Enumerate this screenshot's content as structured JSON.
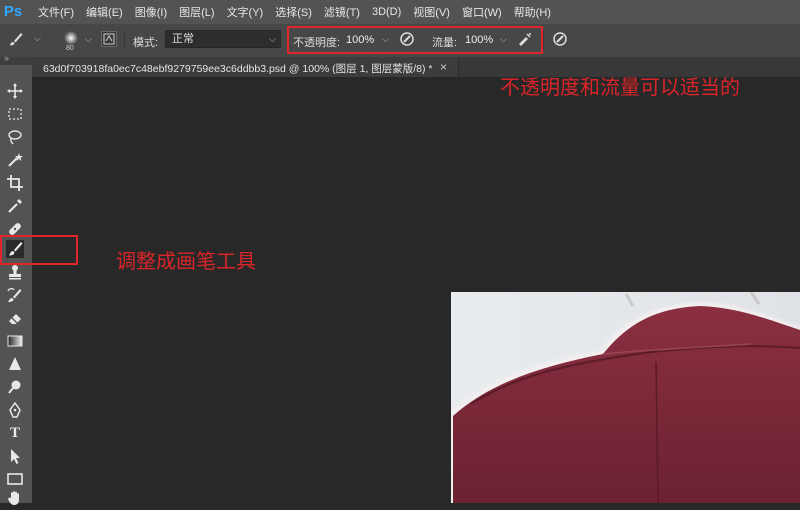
{
  "app": {
    "logo": "Ps"
  },
  "menu": [
    "文件(F)",
    "编辑(E)",
    "图像(I)",
    "图层(L)",
    "文字(Y)",
    "选择(S)",
    "滤镜(T)",
    "3D(D)",
    "视图(V)",
    "窗口(W)",
    "帮助(H)"
  ],
  "options": {
    "brush_size": "80",
    "mode_label": "模式:",
    "mode_value": "正常",
    "opacity_label": "不透明度:",
    "opacity_value": "100%",
    "flow_label": "流量:",
    "flow_value": "100%"
  },
  "document": {
    "tab_title": "63d0f703918fa0ec7c48ebf9279759ee3c6ddbb3.psd @ 100% (图层 1, 图层蒙版/8) *",
    "close_glyph": "×"
  },
  "toolbar": {
    "collapse_glyph": "»",
    "type_tool_glyph": "T",
    "tools": [
      "move-tool",
      "marquee-tool",
      "lasso-tool",
      "quick-select-tool",
      "crop-tool",
      "eyedropper-tool",
      "healing-brush-tool",
      "brush-tool",
      "stamp-tool",
      "history-brush-tool",
      "eraser-tool",
      "gradient-tool",
      "blur-tool",
      "dodge-tool",
      "pen-tool",
      "type-tool",
      "path-select-tool",
      "shape-tool",
      "hand-tool"
    ],
    "active_tool": "brush-tool"
  },
  "annotations": {
    "top": "不透明度和流量可以适当的",
    "tool": "调整成画笔工具"
  },
  "colors": {
    "annotation_red": "#e0262a",
    "ps_blue": "#31a8ff",
    "fabric": "#7a2737"
  }
}
